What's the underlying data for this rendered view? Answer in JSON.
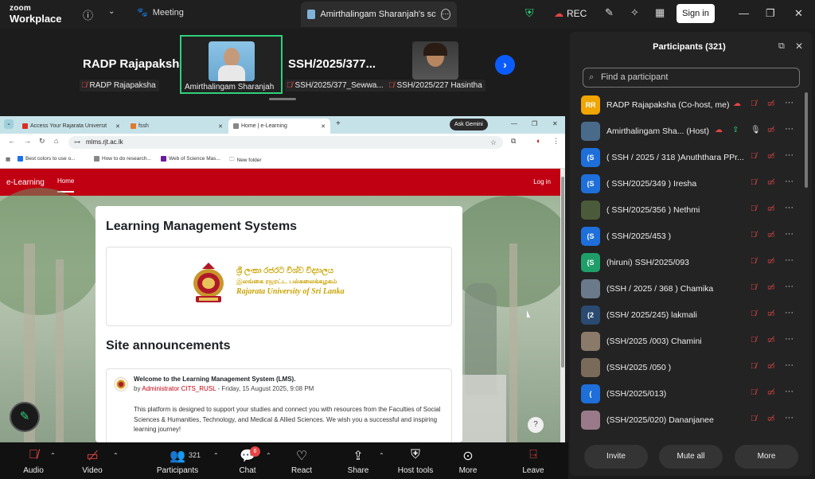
{
  "app": {
    "logo_line1": "zoom",
    "logo_line2": "Workplace"
  },
  "topbar": {
    "meeting_tab": "Meeting",
    "screen_tab": "Amirthalingam Sharanjah's screen",
    "rec": "REC",
    "signin": "Sign in"
  },
  "strip": {
    "big_name_1": "RADP Rajapaksha",
    "label_1": "RADP Rajapaksha",
    "label_active": "Amirthalingam Sharanjah",
    "big_name_2": "SSH/2025/377...",
    "label_3": "SSH/2025/377_Sewwa...",
    "label_4": "SSH/2025/227 Hasintha"
  },
  "browser": {
    "tabs": [
      "Access Your Rajarata Universit",
      "fssh",
      "Home | e-Learning"
    ],
    "gemini": "Ask Gemini",
    "url": "mlms.rjt.ac.lk",
    "bookmarks": [
      "Best colors to use o...",
      "How to do research...",
      "Web of Science Mas...",
      "New folder"
    ]
  },
  "site": {
    "brand": "e-Learning",
    "nav_home": "Home",
    "nav_login": "Log in",
    "page_title": "Learning Management Systems",
    "uni_sinhala": "ශ්‍රී ලංකා රජරට විශ්ව විද්‍යාලය",
    "uni_tamil": "இலங்கை ரஜரட்ட பல்கலைக்கழகம்",
    "uni_english": "Rajarata University of Sri Lanka",
    "announcements_title": "Site announcements",
    "post_title": "Welcome to the Learning Management System (LMS).",
    "post_by_prefix": "by ",
    "post_author": "Administrator CITS_RUSL",
    "post_date": " - Friday, 15 August 2025, 9:08 PM",
    "post_body": "This platform is designed to support your studies and connect you with resources from the Faculties of Social Sciences & Humanities, Technology, and Medical & Allied Sciences. We wish you a successful and inspiring learning journey!",
    "help": "?"
  },
  "toolbar": {
    "audio": "Audio",
    "video": "Video",
    "participants": "Participants",
    "participants_count": "321",
    "chat": "Chat",
    "chat_badge": "6",
    "react": "React",
    "share": "Share",
    "host_tools": "Host tools",
    "more": "More",
    "leave": "Leave"
  },
  "panel": {
    "title": "Participants (321)",
    "search_placeholder": "Find a participant",
    "participants": [
      {
        "initials": "RR",
        "name": "RADP Rajapaksha (Co-host, me)",
        "color": "#f0a500"
      },
      {
        "initials": "",
        "name": "Amirthalingam Sha... (Host)",
        "color": "#4a6a8a"
      },
      {
        "initials": "(S",
        "name": "( SSH / 2025 / 318 )Anuththara PPr...",
        "color": "#1e6fd9"
      },
      {
        "initials": "(S",
        "name": "( SSH/2025/349 ) Iresha",
        "color": "#1e6fd9"
      },
      {
        "initials": "",
        "name": "( SSH/2025/356 ) Nethmi",
        "color": "#4b5a3a"
      },
      {
        "initials": "(S",
        "name": "( SSH/2025/453 )",
        "color": "#1e6fd9"
      },
      {
        "initials": "(S",
        "name": "(hiruni) SSH/2025/093",
        "color": "#1f9e6a"
      },
      {
        "initials": "",
        "name": "(SSH / 2025 / 368 ) Chamika",
        "color": "#6b7a8a"
      },
      {
        "initials": "(2",
        "name": "(SSH/ 2025/245) lakmali",
        "color": "#2a4a70"
      },
      {
        "initials": "",
        "name": "(SSH/2025 /003) Chamini",
        "color": "#8a7a6a"
      },
      {
        "initials": "",
        "name": "(SSH/2025 /050 )",
        "color": "#7a6a5a"
      },
      {
        "initials": "(",
        "name": "(SSH/2025/013)",
        "color": "#1e6fd9"
      },
      {
        "initials": "",
        "name": "(SSH/2025/020) Dananjanee",
        "color": "#9a7a8a"
      }
    ],
    "invite": "Invite",
    "mute_all": "Mute all",
    "more": "More"
  }
}
